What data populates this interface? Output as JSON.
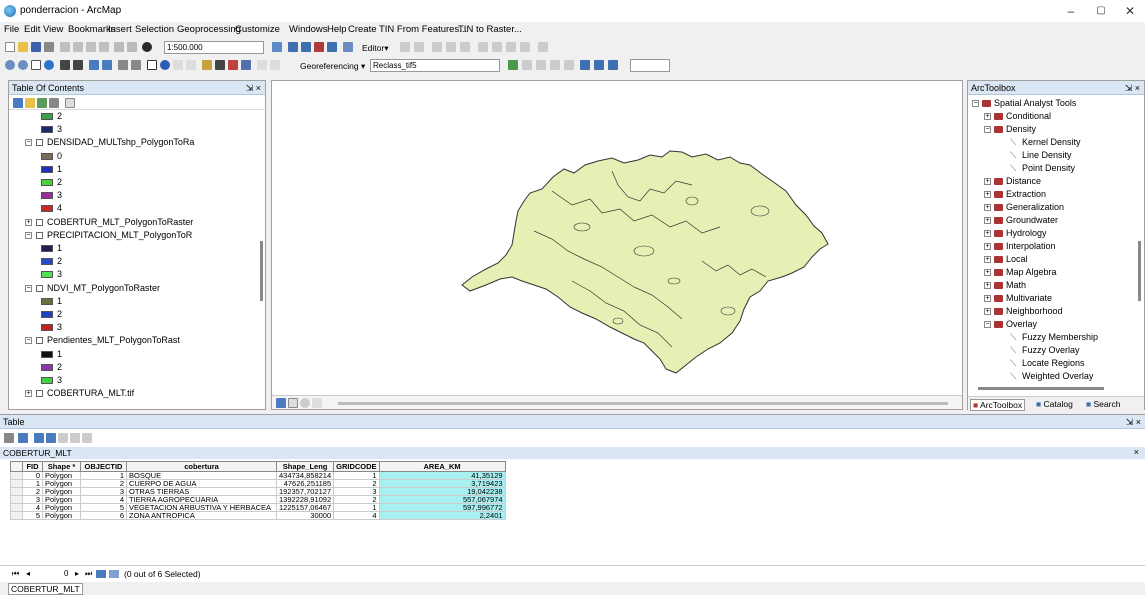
{
  "window": {
    "title": "ponderracion - ArcMap",
    "min": "–",
    "max": "▢",
    "close": "✕"
  },
  "menus": [
    "File",
    "Edit",
    "View",
    "Bookmarks",
    "Insert",
    "Selection",
    "Geoprocessing",
    "Customize",
    "Windows",
    "Help",
    "Create TIN From Features...",
    "TIN to Raster..."
  ],
  "toolbar": {
    "scale": "1:500.000",
    "editor": "Editor▾",
    "georef": "Georeferencing ▾",
    "reclass": "Reclass_tif5"
  },
  "toc": {
    "title": "Table Of Contents",
    "pin": "⇲ ×",
    "rows": [
      {
        "type": "swatch",
        "label": "2",
        "color": "#3fa04a",
        "indent": 1
      },
      {
        "type": "swatch",
        "label": "3",
        "color": "#1a2a6c",
        "indent": 1
      },
      {
        "type": "layer",
        "label": "DENSIDAD_MULTshp_PolygonToRa",
        "exp": "−"
      },
      {
        "type": "swatch",
        "label": "0",
        "color": "#7a6e58",
        "indent": 1
      },
      {
        "type": "swatch",
        "label": "1",
        "color": "#2030b8",
        "indent": 1
      },
      {
        "type": "swatch",
        "label": "2",
        "color": "#4ad23a",
        "indent": 1
      },
      {
        "type": "swatch",
        "label": "3",
        "color": "#9b2a9a",
        "indent": 1
      },
      {
        "type": "swatch",
        "label": "4",
        "color": "#c82828",
        "indent": 1
      },
      {
        "type": "layer",
        "label": "COBERTUR_MLT_PolygonToRaster",
        "exp": "+"
      },
      {
        "type": "layer",
        "label": "PRECIPITACION_MLT_PolygonToR",
        "exp": "−"
      },
      {
        "type": "swatch",
        "label": "1",
        "color": "#1e2050",
        "indent": 1
      },
      {
        "type": "swatch",
        "label": "2",
        "color": "#2848c8",
        "indent": 1
      },
      {
        "type": "swatch",
        "label": "3",
        "color": "#50e050",
        "indent": 1
      },
      {
        "type": "layer",
        "label": "NDVI_MT_PolygonToRaster",
        "exp": "−"
      },
      {
        "type": "swatch",
        "label": "1",
        "color": "#6a7040",
        "indent": 1
      },
      {
        "type": "swatch",
        "label": "2",
        "color": "#2040c0",
        "indent": 1
      },
      {
        "type": "swatch",
        "label": "3",
        "color": "#c02020",
        "indent": 1
      },
      {
        "type": "layer",
        "label": "Pendientes_MLT_PolygonToRast",
        "exp": "−"
      },
      {
        "type": "swatch",
        "label": "1",
        "color": "#101010",
        "indent": 1
      },
      {
        "type": "swatch",
        "label": "2",
        "color": "#8a3aa8",
        "indent": 1
      },
      {
        "type": "swatch",
        "label": "3",
        "color": "#40d040",
        "indent": 1
      },
      {
        "type": "layer",
        "label": "COBERTURA_MLT.tif",
        "exp": "+"
      }
    ]
  },
  "arctoolbox": {
    "title": "ArcToolbox",
    "pin": "⇲ ×",
    "items": [
      {
        "label": "Spatial Analyst Tools",
        "level": 0,
        "kind": "box",
        "exp": "−"
      },
      {
        "label": "Conditional",
        "level": 1,
        "kind": "box",
        "exp": "+"
      },
      {
        "label": "Density",
        "level": 1,
        "kind": "box",
        "exp": "−"
      },
      {
        "label": "Kernel Density",
        "level": 2,
        "kind": "tool"
      },
      {
        "label": "Line Density",
        "level": 2,
        "kind": "tool"
      },
      {
        "label": "Point Density",
        "level": 2,
        "kind": "tool"
      },
      {
        "label": "Distance",
        "level": 1,
        "kind": "box",
        "exp": "+"
      },
      {
        "label": "Extraction",
        "level": 1,
        "kind": "box",
        "exp": "+"
      },
      {
        "label": "Generalization",
        "level": 1,
        "kind": "box",
        "exp": "+"
      },
      {
        "label": "Groundwater",
        "level": 1,
        "kind": "box",
        "exp": "+"
      },
      {
        "label": "Hydrology",
        "level": 1,
        "kind": "box",
        "exp": "+"
      },
      {
        "label": "Interpolation",
        "level": 1,
        "kind": "box",
        "exp": "+"
      },
      {
        "label": "Local",
        "level": 1,
        "kind": "box",
        "exp": "+"
      },
      {
        "label": "Map Algebra",
        "level": 1,
        "kind": "box",
        "exp": "+"
      },
      {
        "label": "Math",
        "level": 1,
        "kind": "box",
        "exp": "+"
      },
      {
        "label": "Multivariate",
        "level": 1,
        "kind": "box",
        "exp": "+"
      },
      {
        "label": "Neighborhood",
        "level": 1,
        "kind": "box",
        "exp": "+"
      },
      {
        "label": "Overlay",
        "level": 1,
        "kind": "box",
        "exp": "−"
      },
      {
        "label": "Fuzzy Membership",
        "level": 2,
        "kind": "tool"
      },
      {
        "label": "Fuzzy Overlay",
        "level": 2,
        "kind": "tool"
      },
      {
        "label": "Locate Regions",
        "level": 2,
        "kind": "tool"
      },
      {
        "label": "Weighted Overlay",
        "level": 2,
        "kind": "tool"
      }
    ],
    "tabs": [
      "ArcToolbox",
      "Catalog",
      "Search"
    ]
  },
  "table": {
    "panel_title": "Table",
    "pin": "⇲ ×",
    "layer_title": "COBERTUR_MLT",
    "close": "×",
    "headers": [
      "FID",
      "Shape *",
      "OBJECTID",
      "cobertura",
      "Shape_Leng",
      "GRIDCODE",
      "AREA_KM"
    ],
    "rows": [
      [
        "0",
        "Polygon",
        "1",
        "BOSQUE",
        "434734,858214",
        "1",
        "41,35129"
      ],
      [
        "1",
        "Polygon",
        "2",
        "CUERPO DE AGUA",
        "47626,251185",
        "2",
        "3,719423"
      ],
      [
        "2",
        "Polygon",
        "3",
        "OTRAS TIERRAS",
        "192357,702127",
        "3",
        "19,042238"
      ],
      [
        "3",
        "Polygon",
        "4",
        "TIERRA AGROPECUARIA",
        "1392228,91092",
        "2",
        "557,067974"
      ],
      [
        "4",
        "Polygon",
        "5",
        "VEGETACION ARBUSTIVA Y HERBACEA",
        "1225157,06467",
        "1",
        "597,996772"
      ],
      [
        "5",
        "Polygon",
        "6",
        "ZONA ANTROPICA",
        "30000",
        "4",
        "2,2401"
      ]
    ],
    "record": "0",
    "selection": "(0 out of 6 Selected)"
  },
  "status_tab": "COBERTUR_MLT",
  "colors": {
    "polygon_fill": "#e6efb4",
    "polygon_stroke": "#333333",
    "highlight": "#a8f0f0",
    "panel_header": "#dbe6f4"
  }
}
